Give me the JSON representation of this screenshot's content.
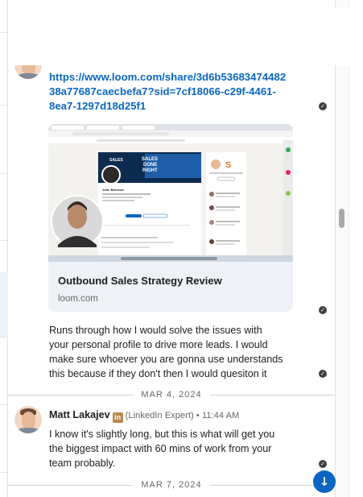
{
  "thread": {
    "link_message": {
      "url": "https://www.loom.com/share/3d6b5368347448238a77687caecbefa7?sid=7cf18066-c29f-4461-8ea7-1297d18d25f1",
      "url_lines": [
        "https://www.loom.com/share/3d6b53683474482",
        "38a77687caecbefa7?sid=7cf18066-c29f-4461-",
        "8ea7-1297d18d25f1"
      ]
    },
    "preview_card": {
      "title": "Outbound Sales Strategy Review",
      "domain": "loom.com",
      "thumb_text": {
        "banner_line1": "SALES",
        "banner_line2": "DONE",
        "banner_line3": "RIGHT",
        "profile_name": "John Barrows"
      }
    },
    "followup_message": {
      "lines": [
        "Runs through how I would solve the issues with",
        "your personal profile to drive more leads. I would",
        "make sure whoever you are gonna use understands",
        "this because if they don't then I would quesiton it"
      ]
    },
    "date_1": "MAR 4, 2024",
    "reply": {
      "sender_name": "Matt Lakajev",
      "badge": "in",
      "role": "(LinkedIn Expert)",
      "time": "11:44 AM",
      "lines": [
        "I know it's slightly long, but this is what will get you",
        "the biggest impact with 60 mins of work from your",
        "team probably."
      ]
    },
    "date_2": "MAR 7, 2024"
  },
  "icons": {
    "read_receipt": "check-circle-icon",
    "scroll_down": "arrow-down-icon"
  },
  "colors": {
    "link": "#0a66c2",
    "scroll_button": "#0a66c2",
    "badge": "#b7874d"
  }
}
